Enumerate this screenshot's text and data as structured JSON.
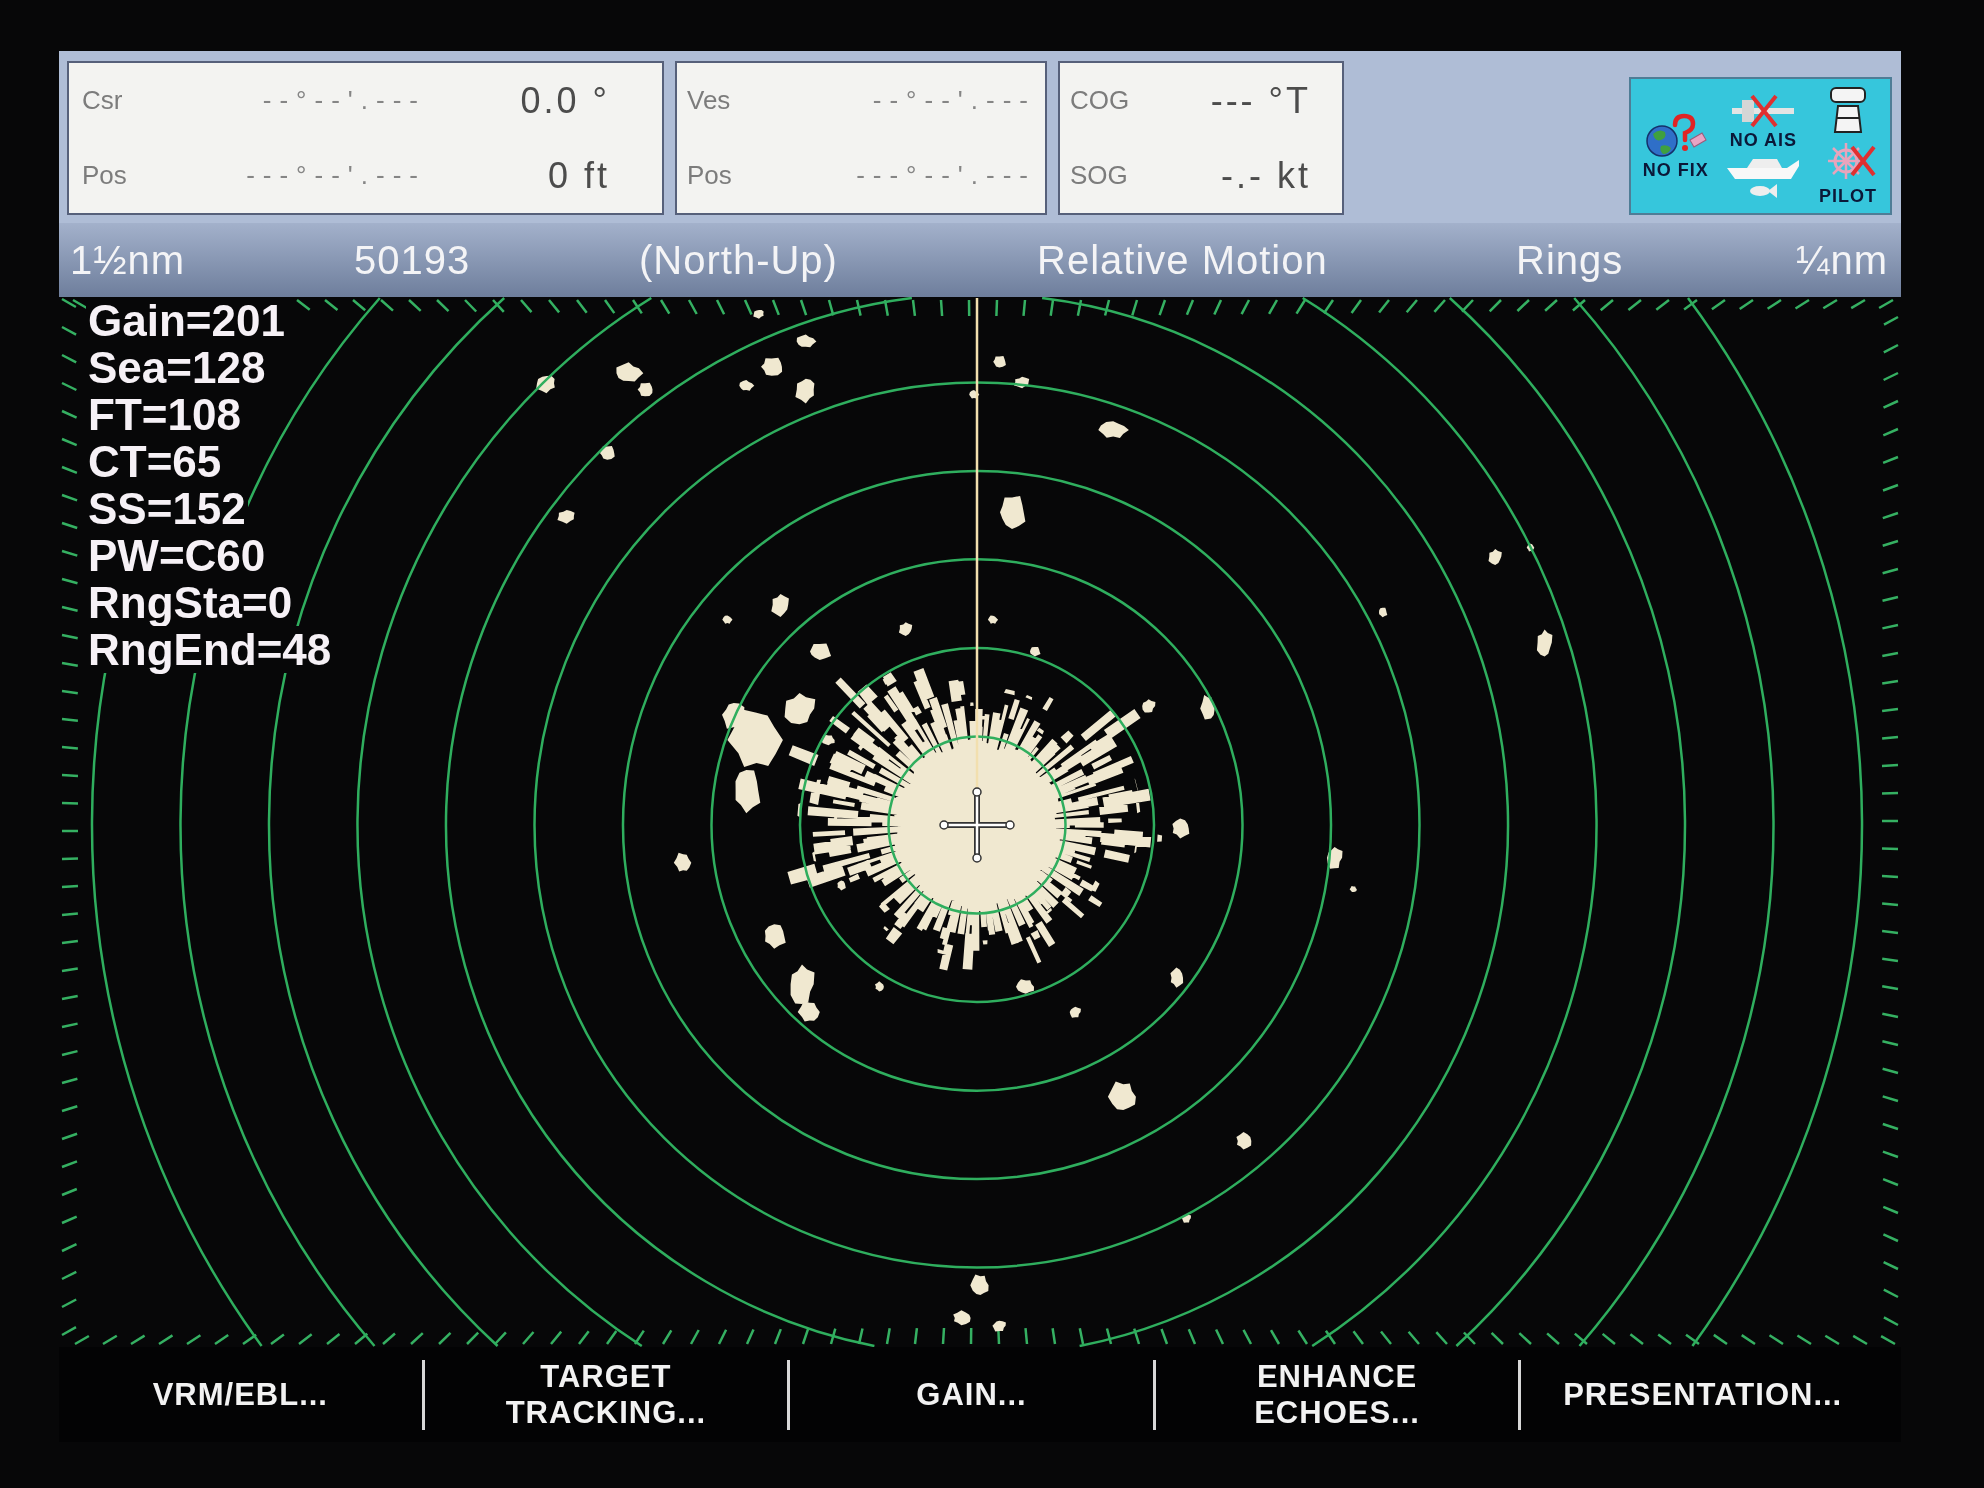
{
  "data_panel": {
    "boxes": [
      {
        "rows": [
          {
            "label": "Csr",
            "position": "--°--'.---",
            "value": "0.0 °"
          },
          {
            "label": "Pos",
            "position": "---°--'.---",
            "value": "0 ft"
          }
        ]
      },
      {
        "rows": [
          {
            "label": "Ves",
            "position": "--°--'.---"
          },
          {
            "label": "Pos",
            "position": "---°--'.---"
          }
        ]
      },
      {
        "rows": [
          {
            "label": "COG",
            "value": "--- °T"
          },
          {
            "label": "SOG",
            "value": "-.- kt"
          }
        ]
      }
    ],
    "status_icons": [
      {
        "kind": "gps",
        "label": "NO FIX"
      },
      {
        "kind": "ais",
        "label": "NO AIS"
      },
      {
        "kind": "pilot",
        "label": "PILOT"
      }
    ]
  },
  "status_bar": {
    "items": [
      "1½nm",
      "50193",
      "(North-Up)",
      "Relative Motion",
      "Rings",
      "¼nm"
    ]
  },
  "radar": {
    "readouts": [
      "Gain=201",
      "Sea=128",
      "FT=108",
      "CT=65",
      "SS=152",
      "PW=C60",
      "RngSta=0",
      "RngEnd=48"
    ]
  },
  "softkeys": [
    {
      "label": "VRM/EBL..."
    },
    {
      "label": "TARGET\nTRACKING..."
    },
    {
      "label": "GAIN..."
    },
    {
      "label": "ENHANCE\nECHOES..."
    },
    {
      "label": "PRESENTATION..."
    }
  ]
}
